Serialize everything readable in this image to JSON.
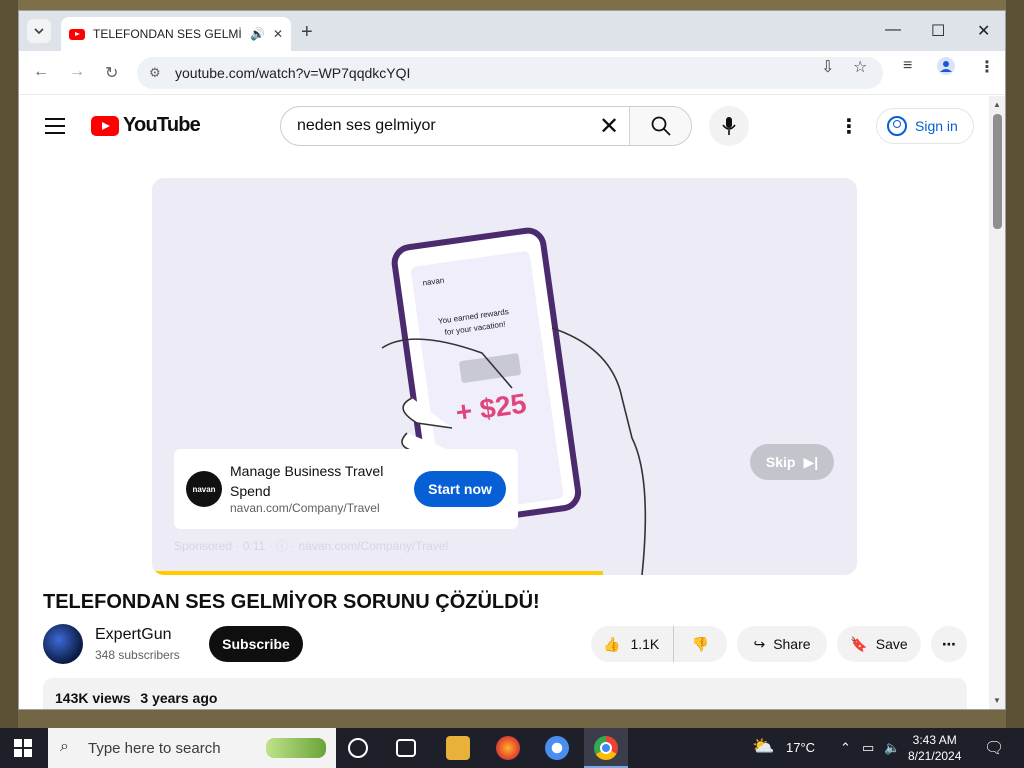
{
  "browser": {
    "tab_title": "TELEFONDAN SES GELMİYOR",
    "url": "youtube.com/watch?v=WP7qqdkcYQI"
  },
  "youtube": {
    "logo_text": "YouTube",
    "search_query": "neden ses gelmiyor",
    "sign_in_label": "Sign in"
  },
  "ad": {
    "title": "Manage Business Travel Spend",
    "url": "navan.com/Company/Travel",
    "cta": "Start now",
    "sponsored": "Sponsored · 0:11 · ⓘ · navan.com/Company/Travel",
    "skip_label": "Skip",
    "logo_text": "navan",
    "progress": 0.64
  },
  "video": {
    "title": "TELEFONDAN SES GELMİYOR SORUNU ÇÖZÜLDÜ!",
    "channel_name": "ExpertGun",
    "subscribers": "348 subscribers",
    "subscribe_label": "Subscribe",
    "likes": "1.1K",
    "share_label": "Share",
    "save_label": "Save",
    "views": "143K views",
    "age": "3 years ago"
  },
  "taskbar": {
    "search_placeholder": "Type here to search",
    "temperature": "17°C",
    "time": "3:43 AM",
    "date": "8/21/2024"
  },
  "colors": {
    "yt_red": "#ff0000",
    "link_blue": "#065fd4",
    "progress_yellow": "#ffcc00"
  }
}
